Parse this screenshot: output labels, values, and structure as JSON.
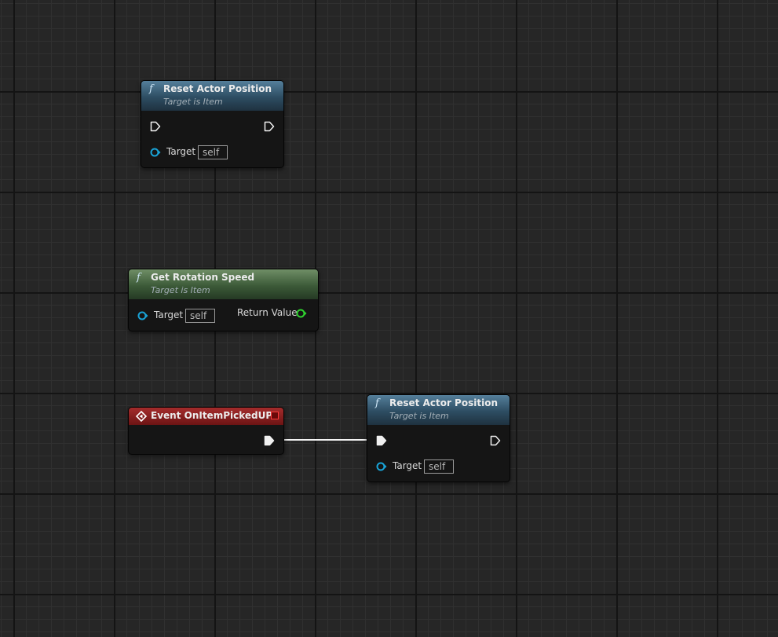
{
  "graph": {
    "nodes": [
      {
        "id": "reset-actor-position-1",
        "kind": "function",
        "icon": "function-icon",
        "title": "Reset Actor Position",
        "subtitle": "Target is Item",
        "pins": {
          "target_label": "Target",
          "target_default": "self"
        }
      },
      {
        "id": "get-rotation-speed",
        "kind": "pure-function",
        "icon": "function-icon",
        "title": "Get Rotation Speed",
        "subtitle": "Target is Item",
        "pins": {
          "target_label": "Target",
          "target_default": "self",
          "return_label": "Return Value"
        }
      },
      {
        "id": "event-on-item-picked-up",
        "kind": "event",
        "icon": "event-diamond-icon",
        "title": "Event OnItemPickedUP"
      },
      {
        "id": "reset-actor-position-2",
        "kind": "function",
        "icon": "function-icon",
        "title": "Reset Actor Position",
        "subtitle": "Target is Item",
        "pins": {
          "target_label": "Target",
          "target_default": "self"
        }
      }
    ],
    "connections": [
      {
        "from": "event-on-item-picked-up.exec-out",
        "to": "reset-actor-position-2.exec-in"
      }
    ]
  },
  "colors": {
    "canvas": "#262626",
    "function_header": "#2d4d62",
    "pure_header": "#3c5a38",
    "event_header": "#7a1818",
    "object_pin": "#19a3d7",
    "return_pin": "#2fd22f",
    "exec_wire": "#ffffff"
  }
}
